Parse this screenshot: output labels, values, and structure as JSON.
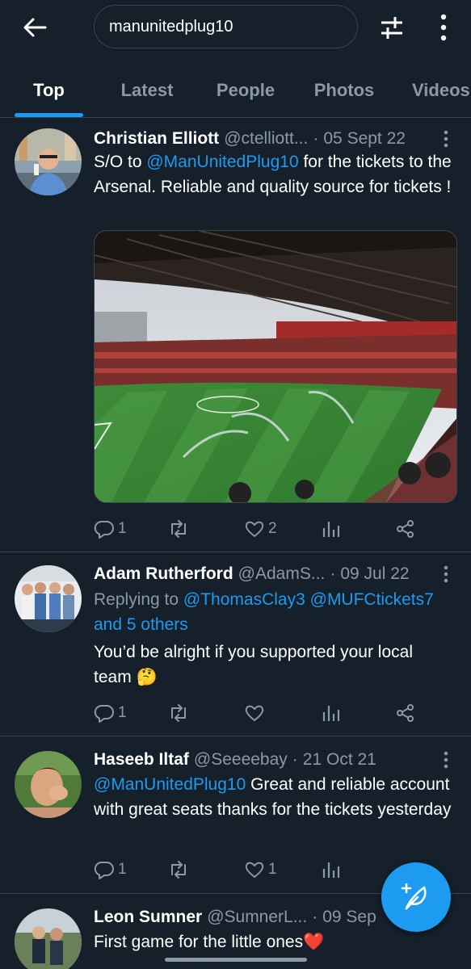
{
  "search": {
    "query": "manunitedplug10"
  },
  "tabs": [
    {
      "label": "Top",
      "active": true
    },
    {
      "label": "Latest",
      "active": false
    },
    {
      "label": "People",
      "active": false
    },
    {
      "label": "Photos",
      "active": false
    },
    {
      "label": "Videos",
      "active": false
    }
  ],
  "tweets": [
    {
      "name": "Christian Elliott",
      "handle": "@ctelliott...",
      "date": "05 Sept 22",
      "text_before": "S/O to ",
      "mention": "@ManUnitedPlug10",
      "text_after": " for the tickets to the Arsenal. Reliable and quality source for tickets !",
      "media": "stadium-photo",
      "replies": "1",
      "retweets": "",
      "likes": "2"
    },
    {
      "name": "Adam Rutherford",
      "handle": "@AdamS...",
      "date": "09 Jul 22",
      "replying_label": "Replying to",
      "replying_mention_1": "@ThomasClay3",
      "replying_mention_2": "@MUFCtickets7",
      "replying_others": "and 5 others",
      "text": "You’d be alright if you supported your local team",
      "emoji": "🤔",
      "replies": "1",
      "retweets": "",
      "likes": ""
    },
    {
      "name": "Haseeb Iltaf",
      "handle": "@Seeeebay",
      "date": "21 Oct 21",
      "mention": "@ManUnitedPlug10",
      "text_after": " Great and reliable account with great seats thanks for the tickets yesterday",
      "replies": "1",
      "retweets": "",
      "likes": "1"
    },
    {
      "name": "Leon Sumner",
      "handle": "@SumnerL...",
      "date": "09 Sep",
      "text": "First game for the little ones",
      "emoji": "❤️"
    }
  ],
  "colors": {
    "background": "#15202b",
    "accent": "#1d9bf0",
    "secondary_text": "#8b98a5",
    "divider": "#38444d"
  },
  "icons": {
    "back": "arrow-left-icon",
    "filter": "sliders-icon",
    "more": "more-vertical-icon",
    "reply": "comment-icon",
    "retweet": "retweet-icon",
    "like": "heart-icon",
    "analytics": "bar-chart-icon",
    "share": "share-icon",
    "compose": "feather-plus-icon"
  }
}
